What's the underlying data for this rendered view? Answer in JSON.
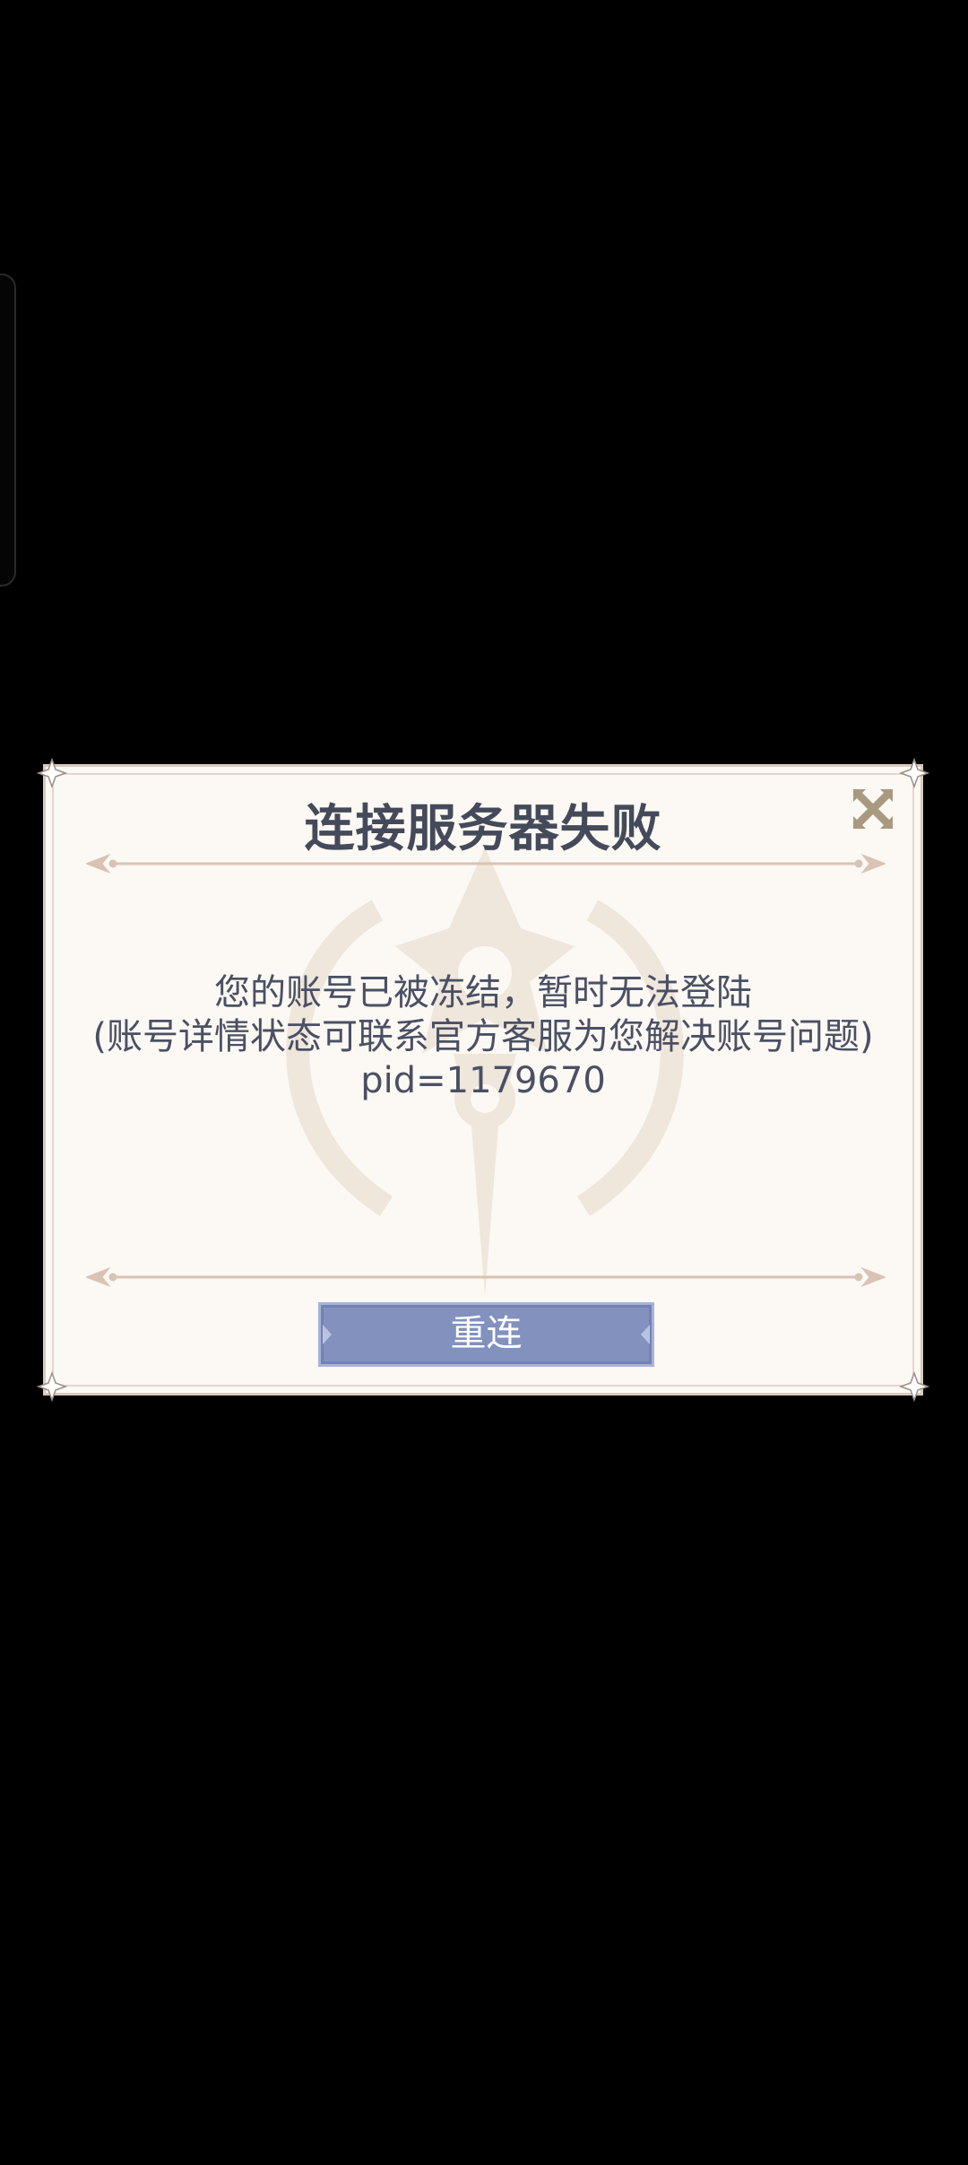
{
  "dialog": {
    "title": "连接服务器失败",
    "message_lines": [
      "您的账号已被冻结，暂时无法登陆",
      "(账号详情状态可联系官方客服为您解决账号问题)",
      "pid=1179670"
    ],
    "reconnect_label": "重连",
    "close_icon": "close-x-icon"
  },
  "colors": {
    "background": "#000000",
    "panel": "#fcf8f3",
    "title_text": "#444a5a",
    "body_text": "#4a5063",
    "button": "#8391bf",
    "close_icon": "#a89a80",
    "ornament": "#d9c3b4"
  }
}
